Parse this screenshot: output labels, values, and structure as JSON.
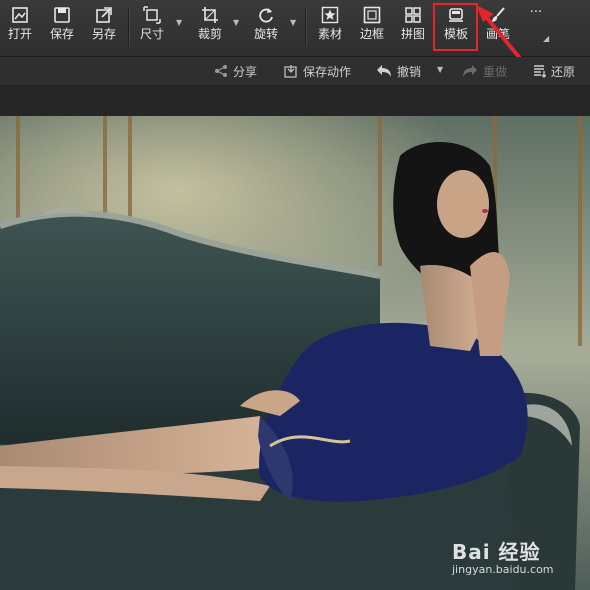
{
  "toolbar": {
    "open": "打开",
    "save": "保存",
    "save_as": "另存",
    "size": "尺寸",
    "crop": "裁剪",
    "rotate": "旋转",
    "material": "素材",
    "border": "边框",
    "collage": "拼图",
    "template": "模板",
    "brush": "画笔",
    "more": "···"
  },
  "subbar": {
    "share": "分享",
    "save_action": "保存动作",
    "undo": "撤销",
    "redo": "重做",
    "restore": "还原"
  },
  "watermark": {
    "brand": "Bai 经验",
    "url": "jingyan.baidu.com"
  },
  "colors": {
    "highlight": "#e2262b",
    "toolbar_bg": "#3a3a3a"
  }
}
